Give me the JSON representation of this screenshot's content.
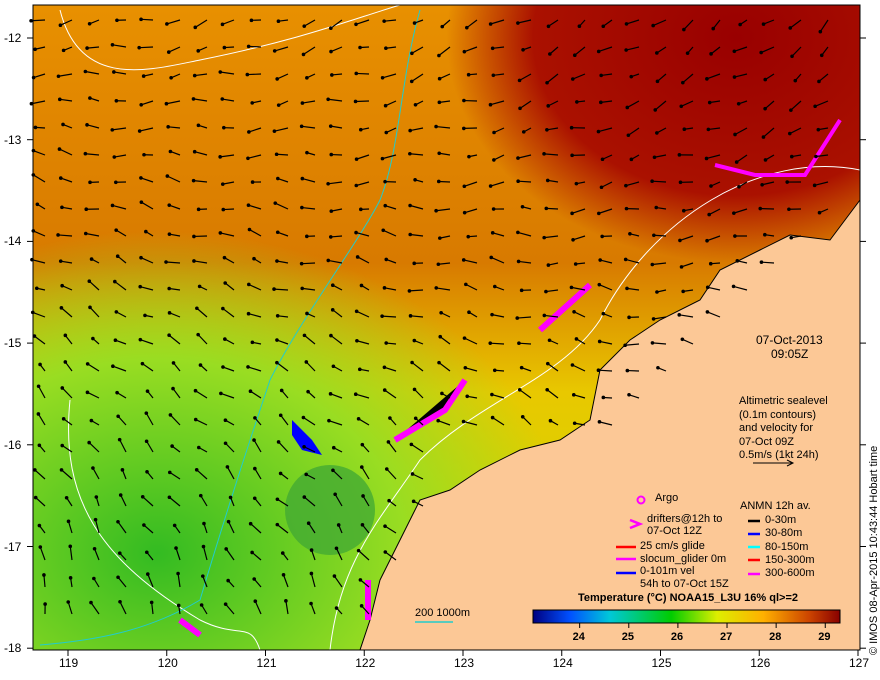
{
  "axes": {
    "x_ticks": [
      "119",
      "120",
      "121",
      "122",
      "123",
      "124",
      "125",
      "126",
      "127"
    ],
    "y_ticks": [
      "-12",
      "-13",
      "-14",
      "-15",
      "-16",
      "-17",
      "-18"
    ]
  },
  "datetime": {
    "date": "07-Oct-2013",
    "time": "09:05Z"
  },
  "altimetry": {
    "lines": [
      "Altimetric sealevel",
      "(0.1m contours)",
      "and velocity for",
      "07-Oct 09Z",
      "0.5m/s (1kt 24h)"
    ]
  },
  "legend": {
    "argo": "Argo",
    "drifters": [
      "drifters@12h to",
      "07-Oct 12Z"
    ],
    "glide": "25 cm/s glide",
    "slocum": "slocum_glider 0m",
    "vel": [
      "0-101m vel",
      "54h to 07-Oct 15Z"
    ],
    "anmn_title": "ANMN 12h av.",
    "anmn": [
      {
        "label": "0-30m",
        "color": "#000000"
      },
      {
        "label": "30-80m",
        "color": "#0000ff"
      },
      {
        "label": "80-150m",
        "color": "#00ffff"
      },
      {
        "label": "150-300m",
        "color": "#ff0000"
      },
      {
        "label": "300-600m",
        "color": "#ff00ff"
      }
    ]
  },
  "depth_legend": "200  1000m",
  "colorbar": {
    "title": "Temperature (°C) NOAA15_L3U 16% ql>=2",
    "ticks": [
      "24",
      "25",
      "26",
      "27",
      "28",
      "29"
    ],
    "range": [
      23.05,
      29.3
    ]
  },
  "credit": "© IMOS 08-Apr-2015 10:43:44 Hobart time"
}
